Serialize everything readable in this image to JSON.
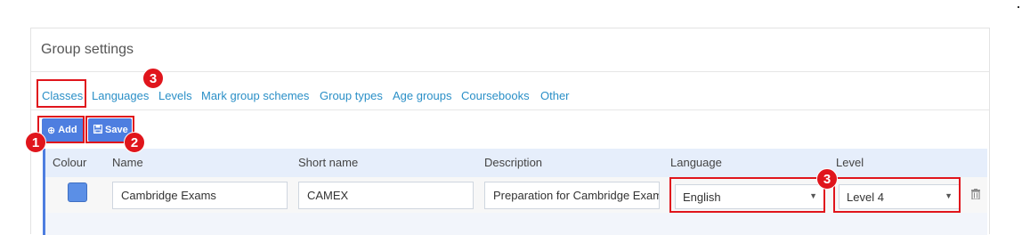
{
  "panel": {
    "title": "Group settings"
  },
  "tabs": [
    {
      "label": "Classes",
      "active": true
    },
    {
      "label": "Languages"
    },
    {
      "label": "Levels"
    },
    {
      "label": "Mark group schemes"
    },
    {
      "label": "Group types"
    },
    {
      "label": "Age groups"
    },
    {
      "label": "Coursebooks"
    },
    {
      "label": "Other"
    }
  ],
  "toolbar": {
    "add_label": "Add",
    "save_label": "Save"
  },
  "table": {
    "columns": [
      "Colour",
      "Name",
      "Short name",
      "Description",
      "Language",
      "Level"
    ],
    "rows": [
      {
        "colour": "#5b8fe6",
        "name": "Cambridge Exams",
        "short_name": "CAMEX",
        "description": "Preparation for Cambridge Exams",
        "language": "English",
        "level": "Level 4"
      }
    ]
  },
  "annotations": {
    "badge1": "1",
    "badge2": "2",
    "badge3a": "3",
    "badge3b": "3"
  },
  "icons": {
    "add": "plus-circle-icon",
    "save": "floppy-disk-icon",
    "delete": "trash-icon",
    "dropdown": "caret-down-icon"
  },
  "colors": {
    "accent": "#4e7ee0",
    "link": "#2a8fc7",
    "annotation": "#e0151c"
  }
}
